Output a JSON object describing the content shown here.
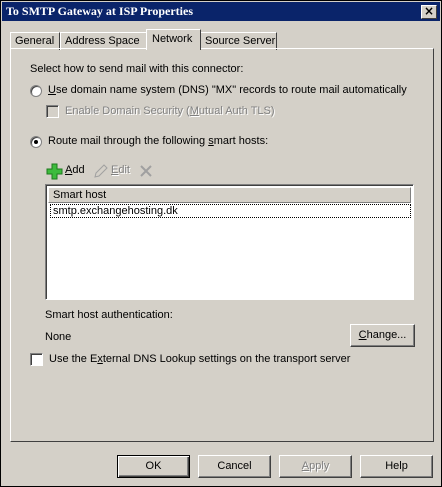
{
  "window": {
    "title": "To SMTP Gateway at ISP Properties",
    "close": "×"
  },
  "tabs": [
    {
      "label": "General"
    },
    {
      "label": "Address Space"
    },
    {
      "label": "Network"
    },
    {
      "label": "Source Server"
    }
  ],
  "network": {
    "intro": "Select how to send mail with this connector:",
    "dns_option": {
      "pre": "",
      "key": "U",
      "post": "se domain name system (DNS) \"MX\" records to route mail automatically",
      "selected": false
    },
    "domain_security": {
      "pre": "Enable Domain Security (",
      "key": "M",
      "post": "utual Auth TLS)",
      "checked": false,
      "disabled": true
    },
    "smart_host_option": {
      "pre": "Route mail through the following ",
      "key": "s",
      "post": "mart hosts:",
      "selected": true
    },
    "toolbar": {
      "add": {
        "key": "A",
        "post": "dd",
        "icon": "plus-icon",
        "icon_color": "#2fa52f"
      },
      "edit": {
        "key": "E",
        "post": "dit",
        "icon": "pencil-icon",
        "disabled": true
      },
      "delete": {
        "icon": "delete-x-icon",
        "disabled": true
      }
    },
    "list": {
      "header": "Smart host",
      "rows": [
        "smtp.exchangehosting.dk"
      ]
    },
    "auth_label": "Smart host authentication:",
    "auth_value": "None",
    "change_button": {
      "key": "C",
      "post": "hange..."
    },
    "external_dns": {
      "pre": "Use the E",
      "key": "x",
      "post": "ternal DNS Lookup settings on the transport server",
      "checked": false
    }
  },
  "buttons": {
    "ok": "OK",
    "cancel": "Cancel",
    "apply": {
      "key": "A",
      "post": "pply",
      "disabled": true
    },
    "help": "Help"
  }
}
